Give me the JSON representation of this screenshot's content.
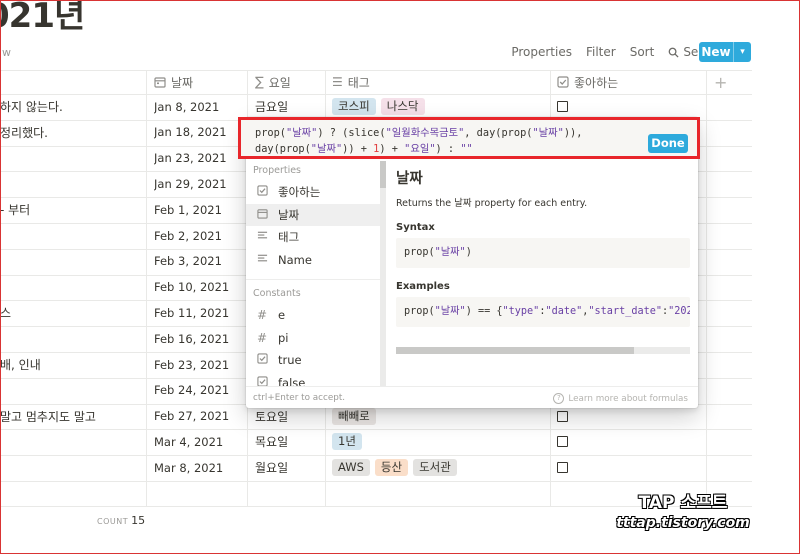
{
  "page": {
    "title": "021년",
    "view_label": "w"
  },
  "toolbar": {
    "properties": "Properties",
    "filter": "Filter",
    "sort": "Sort",
    "search": "Search",
    "more": "···",
    "new": "New"
  },
  "columns": {
    "date": "날짜",
    "day": "요일",
    "tags": "태그",
    "like": "좋아하는",
    "add": "+"
  },
  "rows": [
    {
      "name": "하지 않는다.",
      "date": "Jan 8, 2021",
      "day": "금요일",
      "tags": [
        {
          "t": "코스피",
          "c": "#d3e5ef"
        },
        {
          "t": "나스닥",
          "c": "#f5e0e9"
        }
      ]
    },
    {
      "name": "정리했다.",
      "date": "Jan 18, 2021",
      "day": "",
      "tags": []
    },
    {
      "name": "",
      "date": "Jan 23, 2021",
      "day": "",
      "tags": []
    },
    {
      "name": "",
      "date": "Jan 29, 2021",
      "day": "",
      "tags": []
    },
    {
      "name": "- 부터",
      "date": "Feb 1, 2021",
      "day": "",
      "tags": []
    },
    {
      "name": "",
      "date": "Feb 2, 2021",
      "day": "",
      "tags": []
    },
    {
      "name": "",
      "date": "Feb 3, 2021",
      "day": "",
      "tags": []
    },
    {
      "name": "",
      "date": "Feb 10, 2021",
      "day": "",
      "tags": []
    },
    {
      "name": "스",
      "date": "Feb 11, 2021",
      "day": "",
      "tags": []
    },
    {
      "name": "",
      "date": "Feb 16, 2021",
      "day": "",
      "tags": []
    },
    {
      "name": "배, 인내",
      "date": "Feb 23, 2021",
      "day": "",
      "tags": []
    },
    {
      "name": "",
      "date": "Feb 24, 2021",
      "day": "",
      "tags": []
    },
    {
      "name": "말고 멈추지도 말고",
      "date": "Feb 27, 2021",
      "day": "토요일",
      "tags": [
        {
          "t": "빼빼로",
          "c": "#e9e5e3"
        }
      ]
    },
    {
      "name": "",
      "date": "Mar 4, 2021",
      "day": "목요일",
      "tags": [
        {
          "t": "1년",
          "c": "#d3e5ef"
        }
      ]
    },
    {
      "name": "",
      "date": "Mar 8, 2021",
      "day": "월요일",
      "tags": [
        {
          "t": "AWS",
          "c": "#e3e2e0"
        },
        {
          "t": "등산",
          "c": "#fadec9"
        },
        {
          "t": "도서관",
          "c": "#e3e2e0"
        }
      ]
    }
  ],
  "count": {
    "label": "COUNT",
    "value": "15"
  },
  "formula": {
    "line1_parts": [
      "prop(",
      "\"날짜\"",
      ") ? (slice(",
      "\"일월화수목금토\"",
      ", day(prop(",
      "\"날짜\"",
      ")),"
    ],
    "line2_parts": [
      "day(prop(",
      "\"날짜\"",
      ")) + ",
      "1",
      ") + ",
      "\"요일\"",
      ") : ",
      "\"\""
    ],
    "done": "Done"
  },
  "panel": {
    "properties_header": "Properties",
    "properties": [
      {
        "icon": "checkbox-icon",
        "label": "좋아하는"
      },
      {
        "icon": "calendar-icon",
        "label": "날짜"
      },
      {
        "icon": "text-icon",
        "label": "태그"
      },
      {
        "icon": "text-icon",
        "label": "Name"
      }
    ],
    "constants_header": "Constants",
    "constants": [
      {
        "icon": "hash-icon",
        "label": "e"
      },
      {
        "icon": "hash-icon",
        "label": "pi"
      },
      {
        "icon": "checkbox-icon",
        "label": "true"
      },
      {
        "icon": "checkbox-icon",
        "label": "false"
      }
    ],
    "detail": {
      "title": "날짜",
      "desc": "Returns the 날짜 property for each entry.",
      "syntax_h": "Syntax",
      "syntax_parts": [
        "prop(",
        "\"날짜\"",
        ")"
      ],
      "examples_h": "Examples",
      "example_parts": [
        "prop(",
        "\"날짜\"",
        ") == {",
        "\"type\"",
        ":",
        "\"date\"",
        ",",
        "\"start_date\"",
        ":",
        "\"202"
      ]
    },
    "footer_left": "ctrl+Enter to accept.",
    "footer_right": "Learn more about formulas"
  },
  "watermark": {
    "line1": "TAP 소프트",
    "line2": "tttap.tistory.com"
  }
}
